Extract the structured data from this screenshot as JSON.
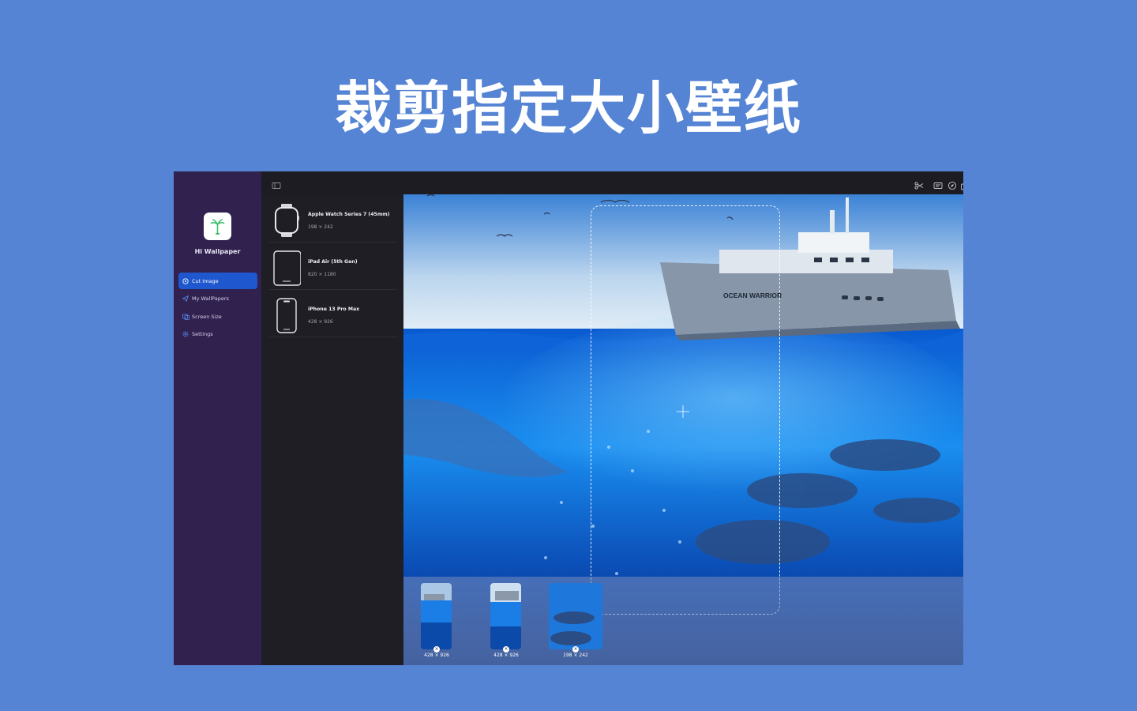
{
  "hero": {
    "title": "裁剪指定大小壁纸"
  },
  "app": {
    "name": "Hi Wallpaper"
  },
  "sidebar": {
    "items": [
      {
        "label": "Cut Image",
        "icon": "scissors-circle-icon",
        "active": true
      },
      {
        "label": "My WallPapers",
        "icon": "paperplane-icon",
        "active": false
      },
      {
        "label": "Screen Size",
        "icon": "screens-icon",
        "active": false
      },
      {
        "label": "Settings",
        "icon": "gear-icon",
        "active": false
      }
    ]
  },
  "toolbar": {
    "left": [
      "sidebar-toggle-icon"
    ],
    "right": [
      "scissors-icon",
      "image-stack-icon",
      "compass-icon",
      "export-icon"
    ]
  },
  "devices": [
    {
      "name": "Apple Watch Series 7 (45mm)",
      "size": "198 × 242",
      "icon": "apple-watch-icon"
    },
    {
      "name": "iPad Air (5th Gen)",
      "size": "820 × 1180",
      "icon": "ipad-icon"
    },
    {
      "name": "iPhone 13 Pro Max",
      "size": "428 × 926",
      "icon": "iphone-icon"
    }
  ],
  "canvas": {
    "ship_text": "OCEAN WARRIOR"
  },
  "thumbnails": [
    {
      "label": "428 × 926"
    },
    {
      "label": "428 × 926"
    },
    {
      "label": "198 × 242"
    }
  ],
  "colors": {
    "background": "#5584d4",
    "sidebar": "#30214f",
    "active": "#1f57cf",
    "panel": "#1f1e24"
  }
}
